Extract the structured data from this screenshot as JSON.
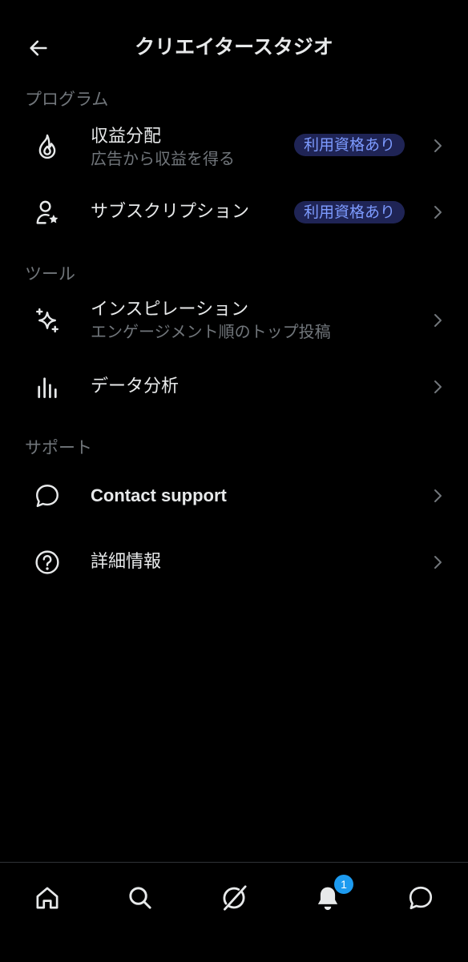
{
  "header": {
    "title": "クリエイタースタジオ",
    "back_icon": "arrow-left-icon"
  },
  "sections": {
    "program": {
      "title": "プログラム",
      "revenue": {
        "label": "収益分配",
        "sub": "広告から収益を得る",
        "badge": "利用資格あり",
        "icon": "flame-icon"
      },
      "subscription": {
        "label": "サブスクリプション",
        "badge": "利用資格あり",
        "icon": "person-star-icon"
      }
    },
    "tools": {
      "title": "ツール",
      "inspiration": {
        "label": "インスピレーション",
        "sub": "エンゲージメント順のトップ投稿",
        "icon": "sparkle-icon"
      },
      "analytics": {
        "label": "データ分析",
        "icon": "bar-chart-icon"
      }
    },
    "support": {
      "title": "サポート",
      "contact": {
        "label": "Contact support",
        "icon": "chat-bubble-icon"
      },
      "info": {
        "label": "詳細情報",
        "icon": "question-circle-icon"
      }
    }
  },
  "bottom_nav": {
    "items": [
      "home-icon",
      "search-icon",
      "grok-icon",
      "bell-icon",
      "messages-icon"
    ],
    "notification_count": "1"
  },
  "colors": {
    "background": "#000000",
    "text_primary": "#e7e9ea",
    "text_secondary": "#71767b",
    "badge_bg": "#1f2455",
    "badge_text": "#7d9bff",
    "accent": "#1d9bf0"
  }
}
